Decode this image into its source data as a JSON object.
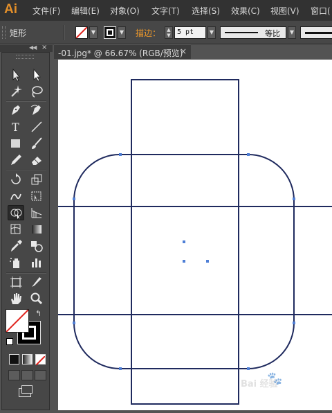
{
  "menubar": {
    "logo": "Ai",
    "items": [
      "文件(F)",
      "编辑(E)",
      "对象(O)",
      "文字(T)",
      "选择(S)",
      "效果(C)",
      "视图(V)",
      "窗口("
    ]
  },
  "options": {
    "tool_name": "矩形",
    "stroke_label": "描边：",
    "stroke_weight": "5 pt",
    "profile_label": "等比"
  },
  "document": {
    "tab_title": "-01.jpg* @ 66.67% (RGB/预览)",
    "close_glyph": "×"
  },
  "colors": {
    "path": "#1f2a5e",
    "anchor": "#4f7fd6",
    "ui_accent": "#e5902a"
  },
  "watermark": {
    "text": "Bai 经验",
    "sub": "🐾"
  },
  "tools": [
    [
      "selection-tool-icon",
      "direct-selection-tool-icon"
    ],
    [
      "magic-wand-tool-icon",
      "lasso-tool-icon"
    ],
    [
      "pen-tool-icon",
      "curvature-tool-icon"
    ],
    [
      "type-tool-icon",
      "line-segment-tool-icon"
    ],
    [
      "rectangle-tool-icon",
      "paintbrush-tool-icon"
    ],
    [
      "pencil-tool-icon",
      "eraser-tool-icon"
    ],
    [
      "rotate-tool-icon",
      "scale-tool-icon"
    ],
    [
      "warp-tool-icon",
      "free-transform-tool-icon"
    ],
    [
      "shape-builder-tool-icon",
      "perspective-grid-tool-icon"
    ],
    [
      "mesh-tool-icon",
      "gradient-tool-icon"
    ],
    [
      "eyedropper-tool-icon",
      "blend-tool-icon"
    ],
    [
      "symbol-sprayer-tool-icon",
      "column-graph-tool-icon"
    ],
    [
      "artboard-tool-icon",
      "slice-tool-icon"
    ],
    [
      "hand-tool-icon",
      "zoom-tool-icon"
    ]
  ]
}
